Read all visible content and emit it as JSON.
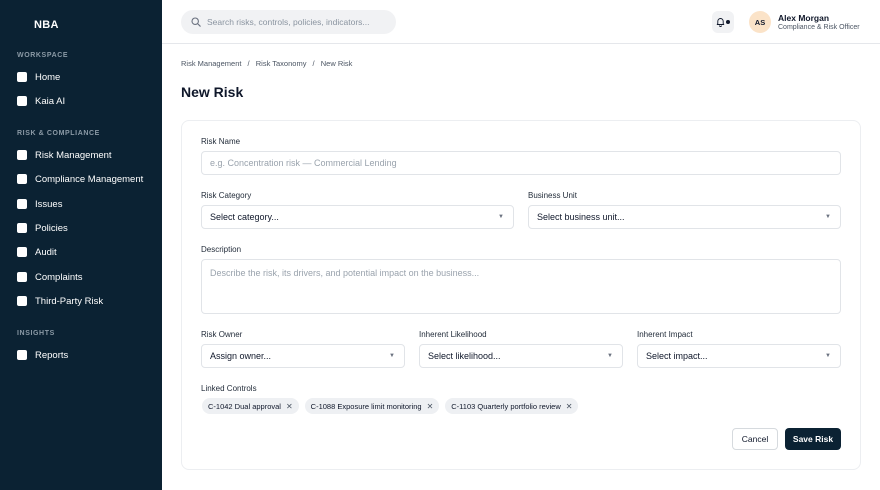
{
  "sidebar": {
    "brand": "NBA",
    "sections": [
      "WORKSPACE",
      "RISK & COMPLIANCE",
      "INSIGHTS"
    ],
    "workspace_items": [
      "Home",
      "Kaia AI"
    ],
    "risk_items": [
      "Risk Management",
      "Compliance Management",
      "Issues",
      "Policies",
      "Audit",
      "Complaints",
      "Third-Party Risk"
    ],
    "insights_items": [
      "Reports"
    ]
  },
  "topbar": {
    "search_placeholder": "Search risks, controls, policies, indicators...",
    "user": {
      "initials": "AS",
      "name": "Alex Morgan",
      "role": "Compliance & Risk Officer"
    }
  },
  "breadcrumb": [
    "Risk Management",
    "/",
    "Risk Taxonomy",
    "/",
    "New Risk"
  ],
  "page_title": "New Risk",
  "form": {
    "risk_name": {
      "label": "Risk Name",
      "placeholder": "e.g. Concentration risk — Commercial Lending",
      "value": ""
    },
    "risk_category": {
      "label": "Risk Category",
      "value": "Select category..."
    },
    "business_unit": {
      "label": "Business Unit",
      "value": "Select business unit..."
    },
    "description": {
      "label": "Description",
      "placeholder": "Describe the risk, its drivers, and potential impact on the business..."
    },
    "risk_owner": {
      "label": "Risk Owner",
      "value": "Assign owner..."
    },
    "likelihood": {
      "label": "Inherent Likelihood",
      "value": "Select likelihood..."
    },
    "impact": {
      "label": "Inherent Impact",
      "value": "Select impact..."
    },
    "linked_controls": {
      "label": "Linked Controls",
      "chips": [
        "C-1042 Dual approval",
        "C-1088 Exposure limit monitoring",
        "C-1103 Quarterly portfolio review"
      ]
    },
    "cancel_label": "Cancel",
    "save_label": "Save Risk"
  },
  "icons": {
    "search": "search-icon",
    "bell": "bell-icon",
    "chevron": "chevron-down-icon",
    "remove": "close-icon"
  },
  "colors": {
    "sidebar_bg": "#0b2233",
    "primary": "#0b2233",
    "avatar_bg": "#fbe3c8"
  }
}
